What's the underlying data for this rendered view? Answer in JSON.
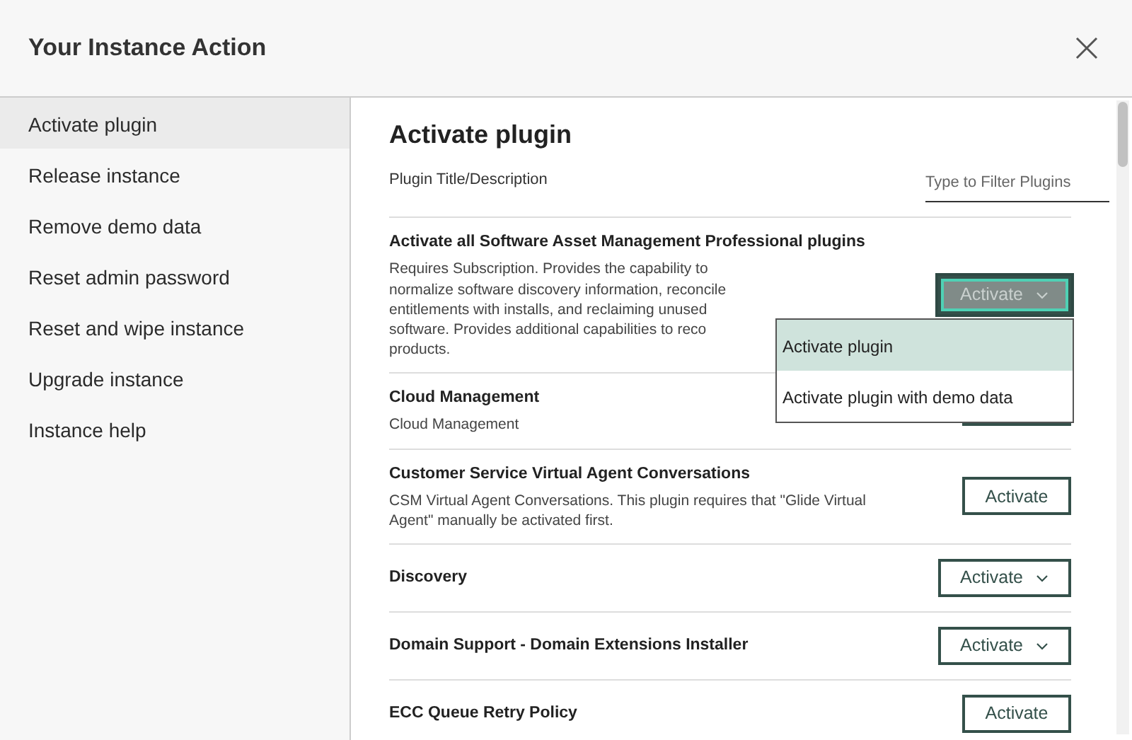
{
  "dialog": {
    "title": "Your Instance Action"
  },
  "sidebar": {
    "items": [
      {
        "label": "Activate plugin",
        "selected": true
      },
      {
        "label": "Release instance",
        "selected": false
      },
      {
        "label": "Remove demo data",
        "selected": false
      },
      {
        "label": "Reset admin password",
        "selected": false
      },
      {
        "label": "Reset and wipe instance",
        "selected": false
      },
      {
        "label": "Upgrade instance",
        "selected": false
      },
      {
        "label": "Instance help",
        "selected": false
      }
    ]
  },
  "content": {
    "heading": "Activate plugin",
    "column_label": "Plugin Title/Description",
    "filter": {
      "placeholder": "Type to Filter Plugins"
    },
    "plugins": [
      {
        "title": "Activate all Software Asset Management Professional plugins",
        "description": "Requires Subscription. Provides the capability to normalize software discovery information, reconcile entitlements with installs, and reclaiming unused software. Provides additional capabilities to reco products.",
        "button": {
          "label": "Activate",
          "kind": "dropdown",
          "open": true,
          "menu_items": [
            {
              "label": "Activate plugin",
              "selected": true
            },
            {
              "label": "Activate plugin with demo data",
              "selected": false
            }
          ]
        }
      },
      {
        "title": "Cloud Management",
        "description": "Cloud Management",
        "button": {
          "kind": "plain",
          "open": false
        }
      },
      {
        "title": "Customer Service Virtual Agent Conversations",
        "description": "CSM Virtual Agent Conversations. This plugin requires that \"Glide Virtual Agent\" manually be activated first.",
        "button": {
          "label": "Activate",
          "kind": "plain",
          "open": false
        }
      },
      {
        "title": "Discovery",
        "button": {
          "label": "Activate",
          "kind": "dropdown",
          "open": false
        }
      },
      {
        "title": "Domain Support - Domain Extensions Installer",
        "button": {
          "label": "Activate",
          "kind": "dropdown",
          "open": false
        }
      },
      {
        "title": "ECC Queue Retry Policy",
        "button": {
          "label": "Activate",
          "kind": "plain",
          "open": false
        }
      }
    ]
  }
}
